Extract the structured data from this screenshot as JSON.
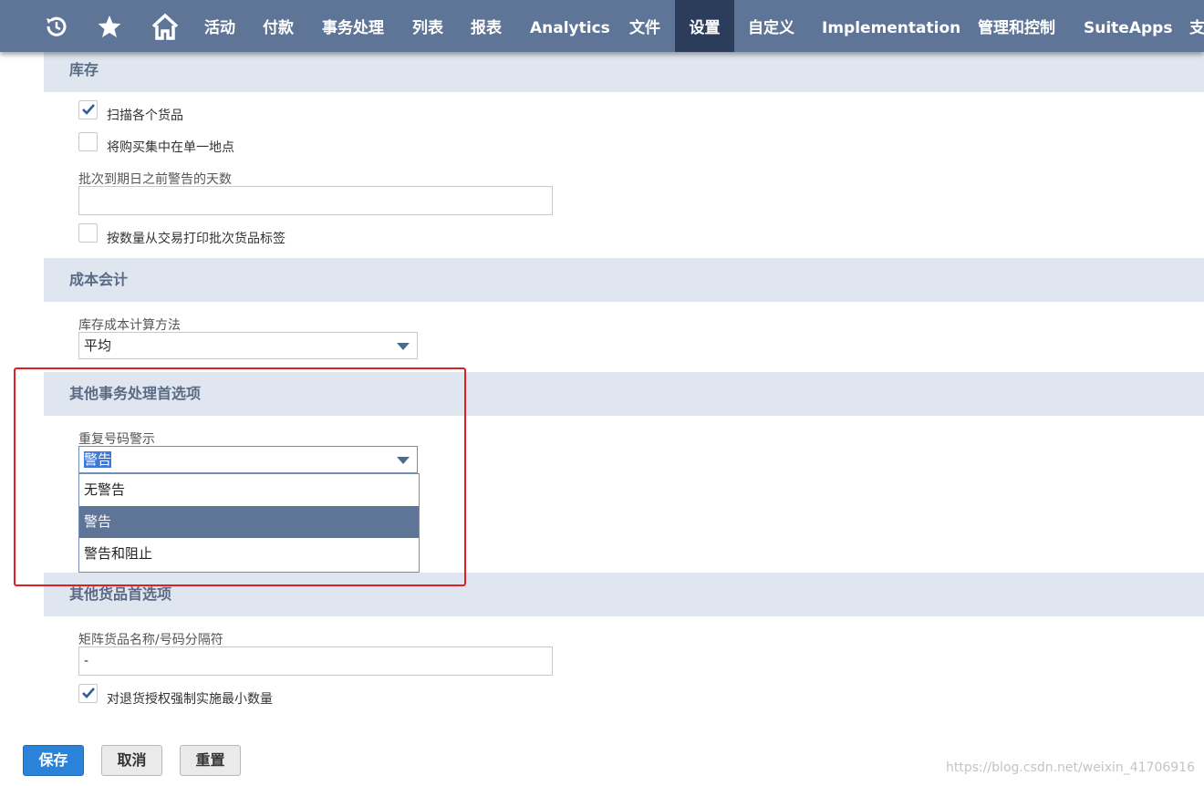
{
  "nav": {
    "icons": [
      "history-icon",
      "star-icon",
      "home-icon"
    ],
    "items": [
      "活动",
      "付款",
      "事务处理",
      "列表",
      "报表",
      "Analytics",
      "文件",
      "设置",
      "自定义",
      "Implementation",
      "管理和控制",
      "SuiteApps",
      "支"
    ],
    "active": "设置"
  },
  "inventory": {
    "title": "库存",
    "scan_items_label": "扫描各个货品",
    "scan_items_checked": true,
    "centralize_purchasing_label": "将购买集中在单一地点",
    "centralize_purchasing_checked": false,
    "lot_expiry_label": "批次到期日之前警告的天数",
    "lot_expiry_value": "",
    "print_lot_labels_label": "按数量从交易打印批次货品标签",
    "print_lot_labels_checked": false
  },
  "cost_accounting": {
    "title": "成本会计",
    "method_label": "库存成本计算方法",
    "method_value": "平均"
  },
  "other_transaction": {
    "title": "其他事务处理首选项",
    "duplicate_label": "重复号码警示",
    "duplicate_value": "警告",
    "options": [
      "无警告",
      "警告",
      "警告和阻止"
    ],
    "selected_option": "警告"
  },
  "other_items": {
    "title": "其他货品首选项",
    "separator_label": "矩阵货品名称/号码分隔符",
    "separator_value": "-",
    "enforce_min_label": "对退货授权强制实施最小数量",
    "enforce_min_checked": true
  },
  "buttons": {
    "save": "保存",
    "cancel": "取消",
    "reset": "重置"
  },
  "watermark": "https://blog.csdn.net/weixin_41706916",
  "colors": {
    "nav_bg": "#5e7597",
    "nav_active": "#2b3d5b",
    "section_bg": "#e0e6ef",
    "primary_button": "#2b82d9",
    "highlight": "#e02020"
  }
}
